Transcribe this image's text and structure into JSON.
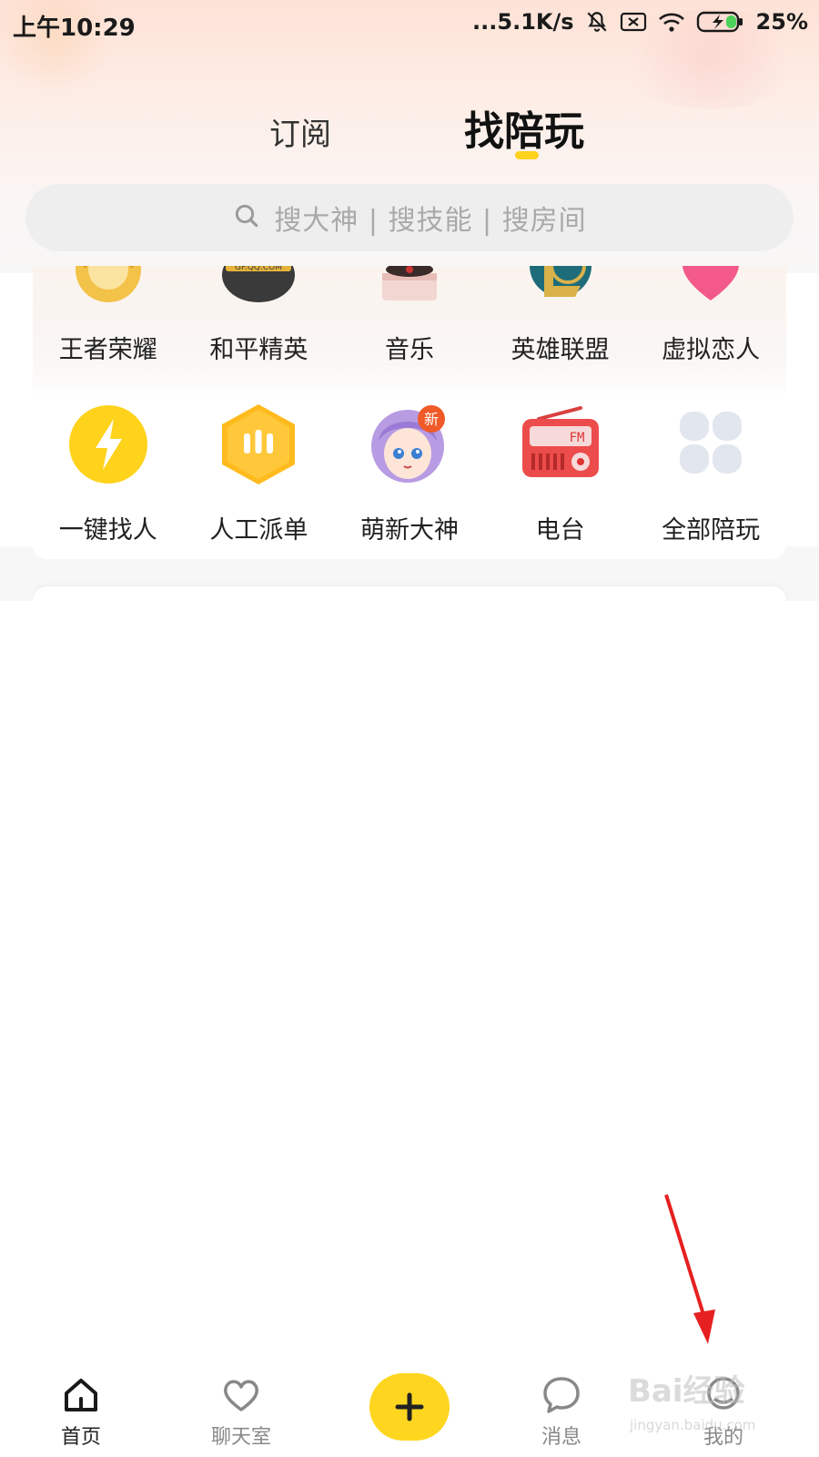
{
  "status_bar": {
    "time": "上午10:29",
    "network_speed": "...5.1K/s",
    "battery": "25%",
    "icons": [
      "mute-icon",
      "no-sim-icon",
      "wifi-icon",
      "battery-charging-icon"
    ]
  },
  "tabs": [
    {
      "label": "订阅",
      "active": false
    },
    {
      "label": "找陪玩",
      "active": true
    }
  ],
  "search": {
    "placeholder": "搜大神 | 搜技能 | 搜房间",
    "icon": "search-icon"
  },
  "categories_row1": [
    {
      "label": "王者荣耀",
      "icon": "honor-of-kings-icon"
    },
    {
      "label": "和平精英",
      "icon": "peacekeeper-elite-icon"
    },
    {
      "label": "音乐",
      "icon": "music-gramophone-icon"
    },
    {
      "label": "英雄联盟",
      "icon": "league-of-legends-icon"
    },
    {
      "label": "虚拟恋人",
      "icon": "virtual-lover-heart-icon"
    }
  ],
  "categories_row2": [
    {
      "label": "一键找人",
      "icon": "lightning-icon"
    },
    {
      "label": "人工派单",
      "icon": "manual-dispatch-icon"
    },
    {
      "label": "萌新大神",
      "icon": "anime-girl-avatar-icon",
      "badge": "新"
    },
    {
      "label": "电台",
      "icon": "radio-fm-icon"
    },
    {
      "label": "全部陪玩",
      "icon": "grid-four-icon"
    }
  ],
  "bottom_nav": [
    {
      "label": "首页",
      "icon": "home-icon",
      "active": true
    },
    {
      "label": "聊天室",
      "icon": "heart-icon",
      "active": false
    },
    {
      "label": "",
      "icon": "plus-icon",
      "active": false
    },
    {
      "label": "消息",
      "icon": "chat-bubble-icon",
      "active": false
    },
    {
      "label": "我的",
      "icon": "profile-icon",
      "active": false
    }
  ],
  "watermark": {
    "text": "Bai经验",
    "sub": "jingyan.baidu.com"
  },
  "colors": {
    "accent": "#ffd21c",
    "plus_button": "#ffd61f",
    "annotation_arrow": "#e62020"
  }
}
